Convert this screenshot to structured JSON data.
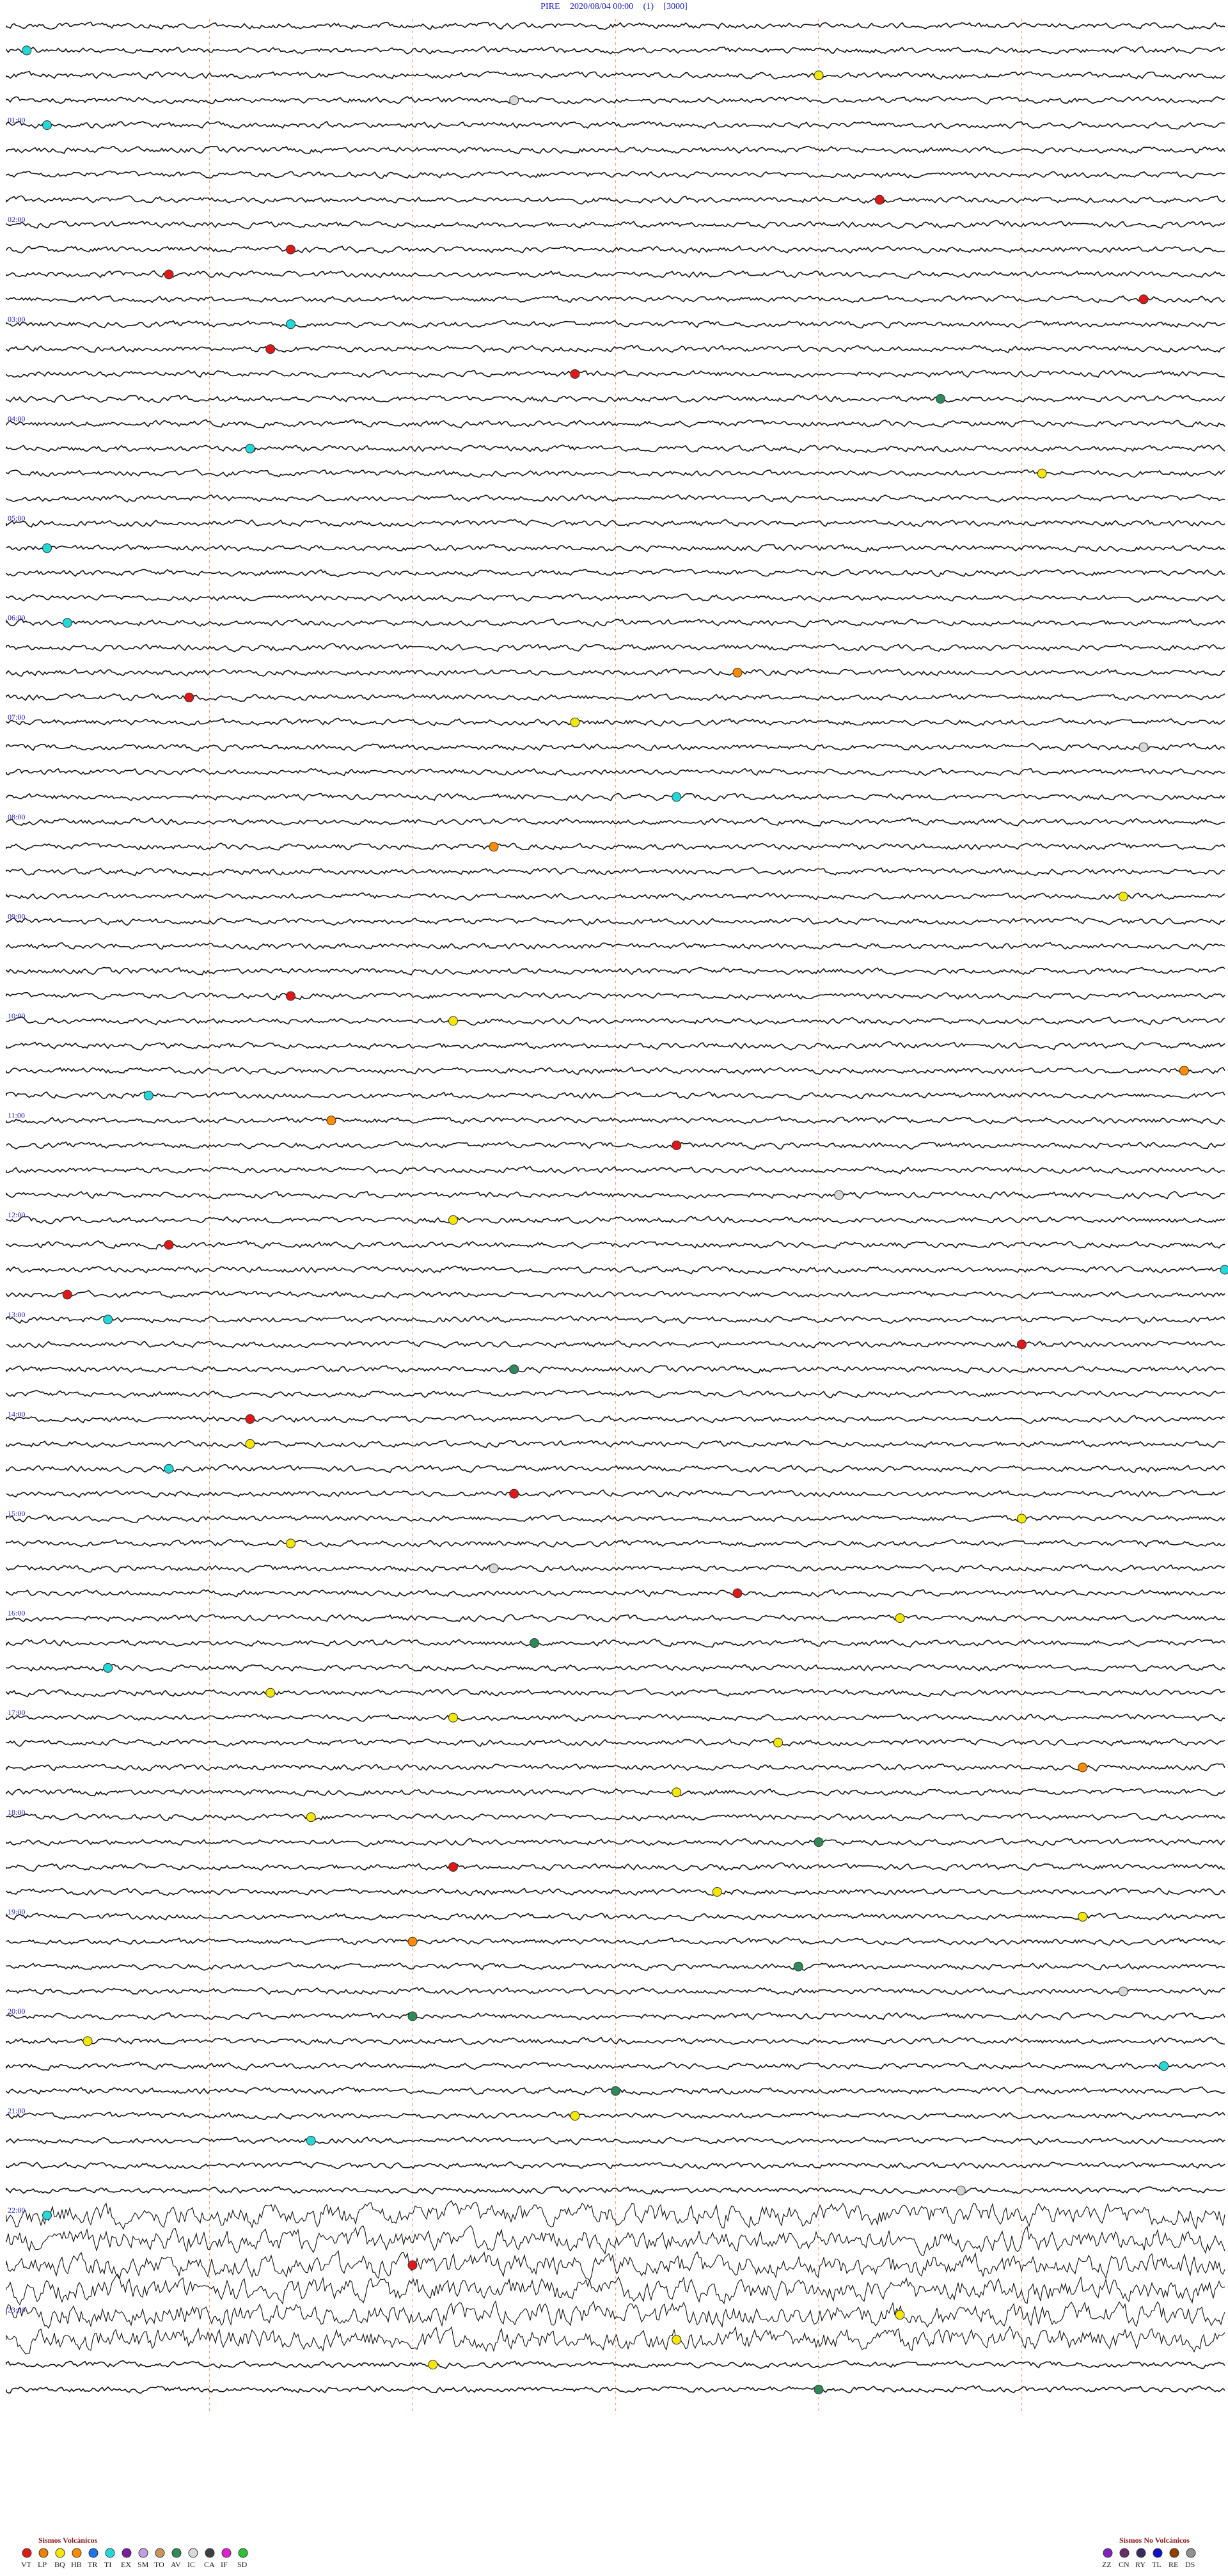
{
  "header": {
    "station": "PIRE",
    "datetime": "2020/08/04 00:00",
    "channel": "(1)",
    "scale": "[3000]"
  },
  "chart_data": {
    "type": "helicorder",
    "title": "PIRE  2020/08/04 00:00  (1)  [3000]",
    "rows_per_hour": 4,
    "hours": 24,
    "hour_labels": [
      "01:00",
      "02:00",
      "03:00",
      "04:00",
      "05:00",
      "06:00",
      "07:00",
      "08:00",
      "09:00",
      "10:00",
      "11:00",
      "12:00",
      "13:00",
      "14:00",
      "15:00",
      "16:00",
      "17:00",
      "18:00",
      "19:00",
      "20:00",
      "21:00",
      "22:00",
      "23:00"
    ],
    "minute_marks": [
      10,
      20,
      30,
      40,
      50
    ],
    "events": [
      {
        "row": 1,
        "minute": 1,
        "type": "TI"
      },
      {
        "row": 2,
        "minute": 40,
        "type": "BQ"
      },
      {
        "row": 3,
        "minute": 25,
        "type": "IC"
      },
      {
        "row": 4,
        "minute": 2,
        "type": "TI"
      },
      {
        "row": 7,
        "minute": 43,
        "type": "VT"
      },
      {
        "row": 9,
        "minute": 14,
        "type": "VT"
      },
      {
        "row": 10,
        "minute": 8,
        "type": "VT"
      },
      {
        "row": 11,
        "minute": 56,
        "type": "VT"
      },
      {
        "row": 12,
        "minute": 14,
        "type": "TI"
      },
      {
        "row": 13,
        "minute": 13,
        "type": "VT"
      },
      {
        "row": 14,
        "minute": 28,
        "type": "VT"
      },
      {
        "row": 15,
        "minute": 46,
        "type": "AV"
      },
      {
        "row": 17,
        "minute": 12,
        "type": "TI"
      },
      {
        "row": 18,
        "minute": 51,
        "type": "BQ"
      },
      {
        "row": 21,
        "minute": 2,
        "type": "TI"
      },
      {
        "row": 24,
        "minute": 3,
        "type": "TI"
      },
      {
        "row": 26,
        "minute": 36,
        "type": "HB"
      },
      {
        "row": 27,
        "minute": 9,
        "type": "VT"
      },
      {
        "row": 28,
        "minute": 28,
        "type": "BQ"
      },
      {
        "row": 29,
        "minute": 56,
        "type": "IC"
      },
      {
        "row": 31,
        "minute": 33,
        "type": "TI"
      },
      {
        "row": 33,
        "minute": 24,
        "type": "HB"
      },
      {
        "row": 35,
        "minute": 55,
        "type": "BQ"
      },
      {
        "row": 39,
        "minute": 14,
        "type": "VT"
      },
      {
        "row": 40,
        "minute": 22,
        "type": "BQ"
      },
      {
        "row": 42,
        "minute": 58,
        "type": "HB"
      },
      {
        "row": 43,
        "minute": 7,
        "type": "TI"
      },
      {
        "row": 44,
        "minute": 16,
        "type": "HB"
      },
      {
        "row": 45,
        "minute": 33,
        "type": "VT"
      },
      {
        "row": 47,
        "minute": 41,
        "type": "IC"
      },
      {
        "row": 48,
        "minute": 22,
        "type": "BQ"
      },
      {
        "row": 49,
        "minute": 8,
        "type": "VT"
      },
      {
        "row": 50,
        "minute": 60,
        "type": "TI"
      },
      {
        "row": 51,
        "minute": 3,
        "type": "VT"
      },
      {
        "row": 52,
        "minute": 5,
        "type": "TI"
      },
      {
        "row": 53,
        "minute": 50,
        "type": "VT"
      },
      {
        "row": 54,
        "minute": 25,
        "type": "AV"
      },
      {
        "row": 56,
        "minute": 12,
        "type": "VT"
      },
      {
        "row": 57,
        "minute": 12,
        "type": "BQ"
      },
      {
        "row": 58,
        "minute": 8,
        "type": "TI"
      },
      {
        "row": 59,
        "minute": 25,
        "type": "VT"
      },
      {
        "row": 60,
        "minute": 50,
        "type": "BQ"
      },
      {
        "row": 61,
        "minute": 14,
        "type": "BQ"
      },
      {
        "row": 62,
        "minute": 24,
        "type": "IC"
      },
      {
        "row": 63,
        "minute": 36,
        "type": "VT"
      },
      {
        "row": 64,
        "minute": 44,
        "type": "BQ"
      },
      {
        "row": 65,
        "minute": 26,
        "type": "AV"
      },
      {
        "row": 66,
        "minute": 5,
        "type": "TI"
      },
      {
        "row": 67,
        "minute": 13,
        "type": "BQ"
      },
      {
        "row": 68,
        "minute": 22,
        "type": "BQ"
      },
      {
        "row": 69,
        "minute": 38,
        "type": "BQ"
      },
      {
        "row": 70,
        "minute": 53,
        "type": "HB"
      },
      {
        "row": 71,
        "minute": 33,
        "type": "BQ"
      },
      {
        "row": 72,
        "minute": 15,
        "type": "BQ"
      },
      {
        "row": 73,
        "minute": 40,
        "type": "AV"
      },
      {
        "row": 74,
        "minute": 22,
        "type": "VT"
      },
      {
        "row": 75,
        "minute": 35,
        "type": "BQ"
      },
      {
        "row": 76,
        "minute": 53,
        "type": "BQ"
      },
      {
        "row": 77,
        "minute": 20,
        "type": "HB"
      },
      {
        "row": 78,
        "minute": 39,
        "type": "AV"
      },
      {
        "row": 79,
        "minute": 55,
        "type": "IC"
      },
      {
        "row": 80,
        "minute": 20,
        "type": "AV"
      },
      {
        "row": 81,
        "minute": 4,
        "type": "BQ"
      },
      {
        "row": 82,
        "minute": 57,
        "type": "TI"
      },
      {
        "row": 83,
        "minute": 30,
        "type": "AV"
      },
      {
        "row": 84,
        "minute": 28,
        "type": "BQ"
      },
      {
        "row": 85,
        "minute": 15,
        "type": "TI"
      },
      {
        "row": 87,
        "minute": 47,
        "type": "IC"
      },
      {
        "row": 88,
        "minute": 2,
        "type": "TI"
      },
      {
        "row": 90,
        "minute": 20,
        "type": "VT"
      },
      {
        "row": 92,
        "minute": 44,
        "type": "BQ"
      },
      {
        "row": 93,
        "minute": 33,
        "type": "BQ"
      },
      {
        "row": 94,
        "minute": 21,
        "type": "BQ"
      },
      {
        "row": 95,
        "minute": 40,
        "type": "AV"
      }
    ],
    "legend_volcanic": {
      "title": "Sismos Volcánicos",
      "items": [
        {
          "code": "VT",
          "color": "#e01818"
        },
        {
          "code": "LP",
          "color": "#f08000"
        },
        {
          "code": "BQ",
          "color": "#f5e800"
        },
        {
          "code": "HB",
          "color": "#ff8c00"
        },
        {
          "code": "TR",
          "color": "#1e74e8"
        },
        {
          "code": "TI",
          "color": "#22d8d8"
        },
        {
          "code": "EX",
          "color": "#7a1f9c"
        },
        {
          "code": "SM",
          "color": "#c0a0e0"
        },
        {
          "code": "TO",
          "color": "#c89658"
        },
        {
          "code": "AV",
          "color": "#2e8b57"
        },
        {
          "code": "IC",
          "color": "#d8d8d8"
        },
        {
          "code": "CA",
          "color": "#404040"
        },
        {
          "code": "IF",
          "color": "#e020d0"
        },
        {
          "code": "SD",
          "color": "#30c030"
        }
      ]
    },
    "legend_nonvolcanic": {
      "title": "Sismos No Volcánicos",
      "items": [
        {
          "code": "ZZ",
          "color": "#8020c0"
        },
        {
          "code": "CN",
          "color": "#6a2d6a"
        },
        {
          "code": "RY",
          "color": "#3a2a60"
        },
        {
          "code": "TL",
          "color": "#1010c8"
        },
        {
          "code": "RE",
          "color": "#904000"
        },
        {
          "code": "DS",
          "color": "#909090"
        }
      ]
    }
  }
}
